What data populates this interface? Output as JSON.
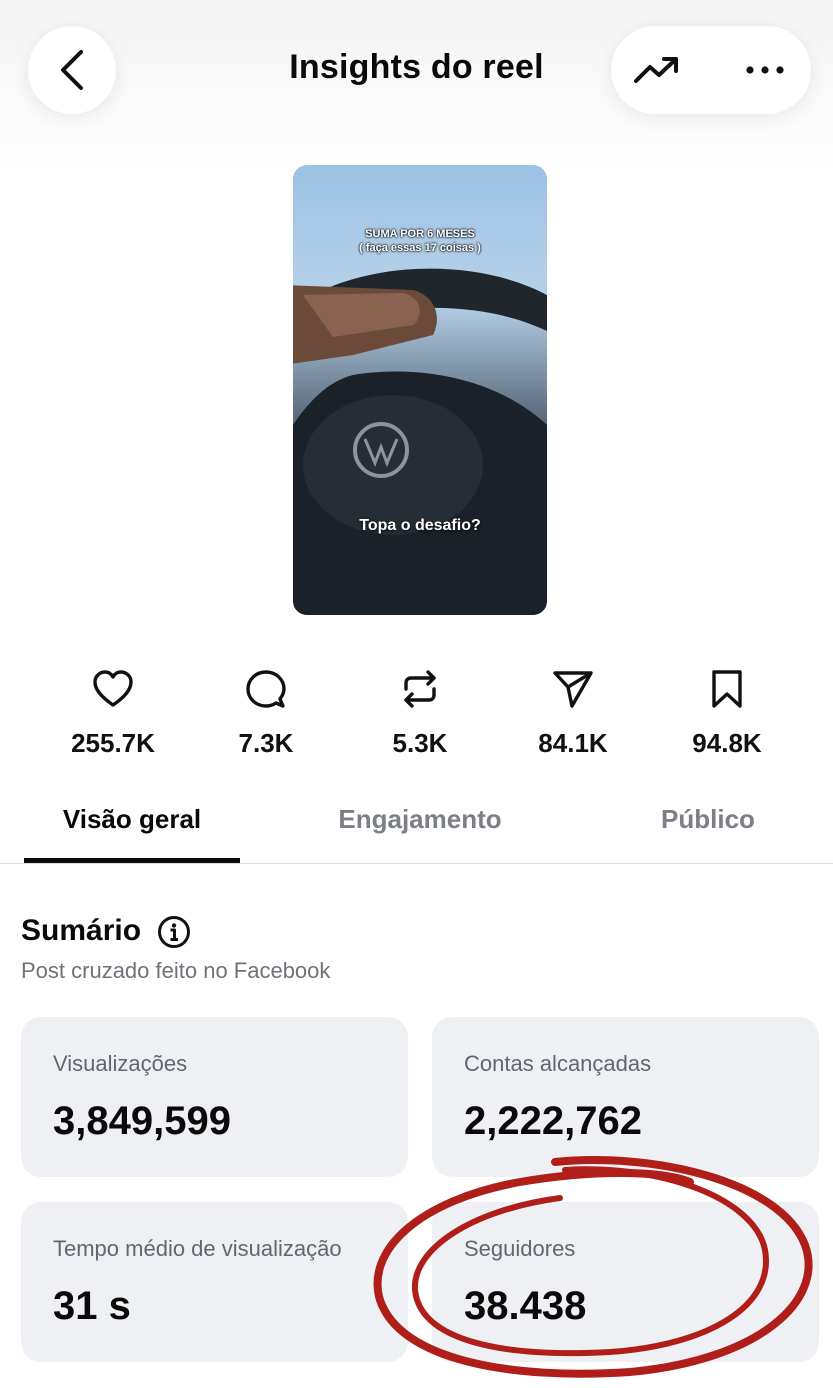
{
  "header": {
    "title": "Insights do reel",
    "icons": [
      "chevron-left-icon",
      "trending-up-icon",
      "more-horizontal-icon"
    ]
  },
  "thumbnail": {
    "caption_top_line1": "SUMA POR 6 MESES",
    "caption_top_line2": "( faça essas 17 coisas )",
    "caption_bottom": "Topa o desafio?"
  },
  "stats": [
    {
      "icon": "heart-icon",
      "value": "255.7K"
    },
    {
      "icon": "comment-icon",
      "value": "7.3K"
    },
    {
      "icon": "repost-icon",
      "value": "5.3K"
    },
    {
      "icon": "share-icon",
      "value": "84.1K"
    },
    {
      "icon": "bookmark-icon",
      "value": "94.8K"
    }
  ],
  "tabs": [
    {
      "label": "Visão geral",
      "active": true
    },
    {
      "label": "Engajamento",
      "active": false
    },
    {
      "label": "Público",
      "active": false
    }
  ],
  "summary": {
    "title": "Sumário",
    "subtitle": "Post cruzado feito no Facebook",
    "cards": [
      {
        "label": "Visualizações",
        "value": "3,849,599"
      },
      {
        "label": "Contas alcançadas",
        "value": "2,222,762"
      },
      {
        "label": "Tempo médio de visualização",
        "value": "31 s"
      },
      {
        "label": "Seguidores",
        "value": "38.438"
      }
    ]
  },
  "colors": {
    "card_bg": "#eef0f4",
    "muted_text": "#7c7f86",
    "annotation_red": "#b01e1a"
  }
}
